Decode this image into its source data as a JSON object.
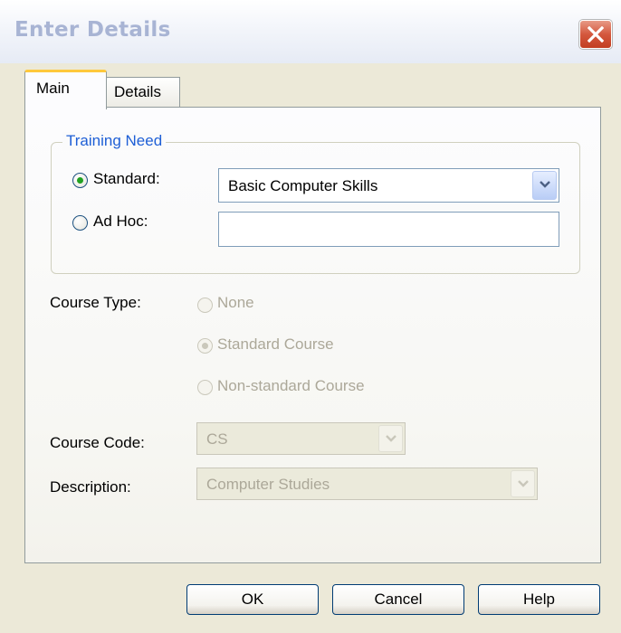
{
  "window": {
    "title": "Enter Details"
  },
  "tabs": [
    {
      "label": "Main"
    },
    {
      "label": "Details"
    }
  ],
  "training_need": {
    "legend": "Training Need",
    "standard": {
      "label": "Standard:",
      "checked": true,
      "value": "Basic Computer Skills"
    },
    "adhoc": {
      "label": "Ad Hoc:",
      "checked": false,
      "value": ""
    }
  },
  "course_type": {
    "label": "Course Type:",
    "options": [
      {
        "label": "None",
        "checked": false
      },
      {
        "label": "Standard Course",
        "checked": true
      },
      {
        "label": "Non-standard Course",
        "checked": false
      }
    ],
    "enabled": false
  },
  "course_code": {
    "label": "Course Code:",
    "value": "CS",
    "enabled": false
  },
  "description": {
    "label": "Description:",
    "value": "Computer Studies",
    "enabled": false
  },
  "buttons": {
    "ok": "OK",
    "cancel": "Cancel",
    "help": "Help"
  },
  "colors": {
    "accent_blue": "#1e5fd6",
    "tab_highlight": "#ffc83c",
    "close_red": "#d4583e",
    "radio_green": "#21a121"
  }
}
